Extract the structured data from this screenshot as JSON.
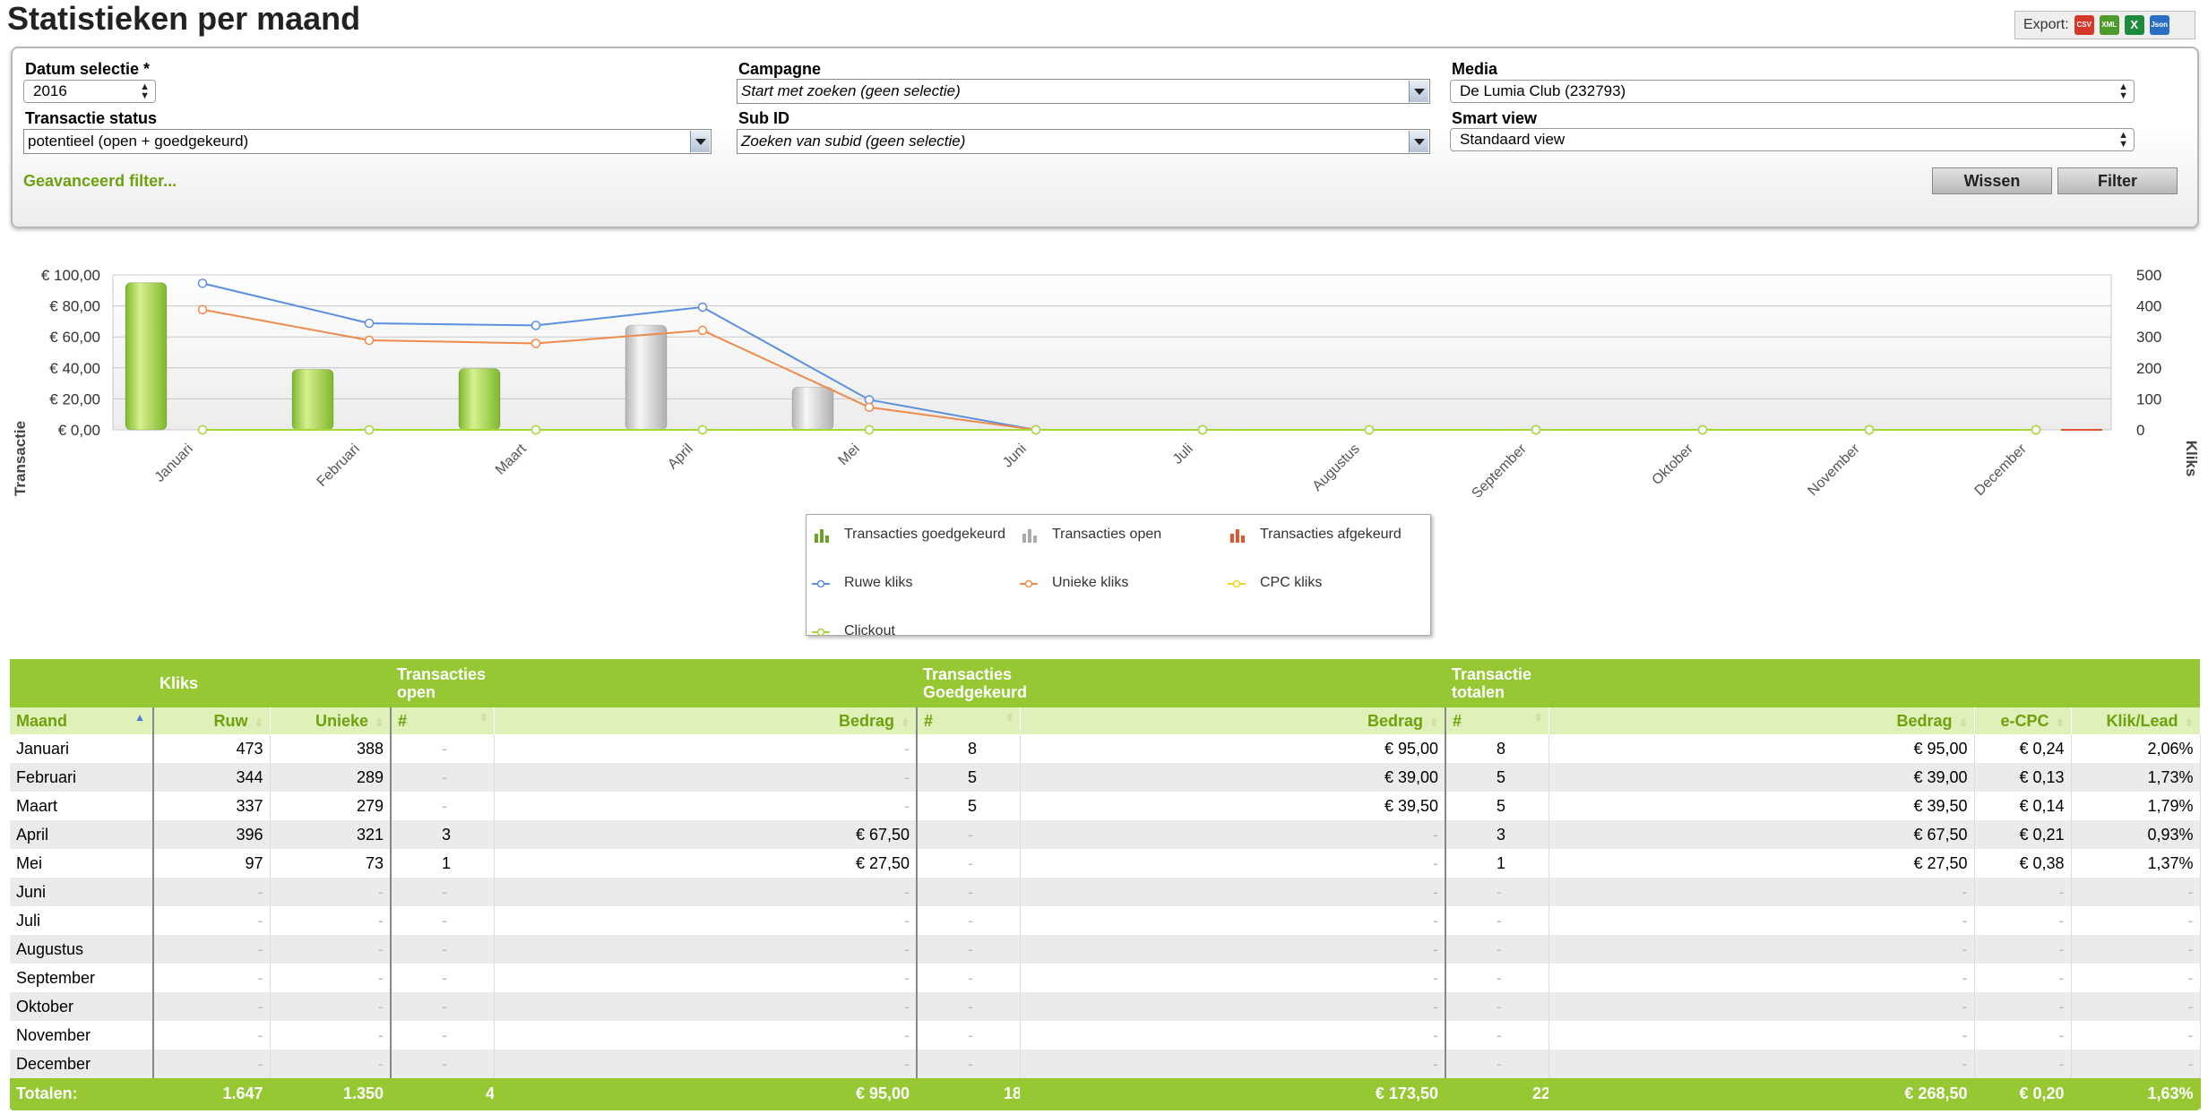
{
  "page": {
    "title": "Statistieken per maand"
  },
  "export": {
    "label": "Export:",
    "formats": [
      {
        "name": "CSV",
        "color": "#d6372b"
      },
      {
        "name": "XML",
        "color": "#4f9a2a"
      },
      {
        "name": "X",
        "color": "#1e8a3c"
      },
      {
        "name": "Json",
        "color": "#2a6fc4"
      }
    ]
  },
  "filters": {
    "datum": {
      "label": "Datum selectie *",
      "value": "2016"
    },
    "transactie_status": {
      "label": "Transactie status",
      "value": "potentieel (open + goedgekeurd)"
    },
    "campagne": {
      "label": "Campagne",
      "value": "Start met zoeken (geen selectie)"
    },
    "subid": {
      "label": "Sub ID",
      "value": "Zoeken van subid (geen selectie)"
    },
    "media": {
      "label": "Media",
      "value": "De Lumia Club (232793)"
    },
    "smart_view": {
      "label": "Smart view",
      "value": "Standaard view"
    },
    "advanced_link": "Geavanceerd filter...",
    "wissen": "Wissen",
    "filter": "Filter"
  },
  "chart_data": {
    "type": "bar+line",
    "categories": [
      "Januari",
      "Februari",
      "Maart",
      "April",
      "Mei",
      "Juni",
      "Juli",
      "Augustus",
      "September",
      "Oktober",
      "November",
      "December"
    ],
    "y_left": {
      "label": "Transactie",
      "range": [
        0,
        100
      ],
      "ticks": [
        "€ 0,00",
        "€ 20,00",
        "€ 40,00",
        "€ 60,00",
        "€ 80,00",
        "€ 100,00"
      ]
    },
    "y_right": {
      "label": "Kliks",
      "range": [
        0,
        500
      ],
      "ticks": [
        "0",
        "100",
        "200",
        "300",
        "400",
        "500"
      ]
    },
    "bar_series": [
      {
        "name": "Transacties goedgekeurd",
        "color": "#8cc63f",
        "values": [
          95,
          39,
          39.5,
          0,
          0,
          0,
          0,
          0,
          0,
          0,
          0,
          0
        ]
      },
      {
        "name": "Transacties open",
        "color": "#bdbdbd",
        "values": [
          0,
          0,
          0,
          67.5,
          27.5,
          0,
          0,
          0,
          0,
          0,
          0,
          0
        ]
      },
      {
        "name": "Transacties afgekeurd",
        "color": "#e2562e",
        "values": [
          0,
          0,
          0,
          0,
          0,
          0,
          0,
          0,
          0,
          0,
          0,
          0
        ]
      }
    ],
    "line_series": [
      {
        "name": "Ruwe kliks",
        "color": "#5b8fe0",
        "values": [
          473,
          344,
          337,
          396,
          97,
          0,
          0,
          0,
          0,
          0,
          0,
          0
        ]
      },
      {
        "name": "Unieke kliks",
        "color": "#f08a4b",
        "values": [
          388,
          289,
          279,
          321,
          73,
          0,
          0,
          0,
          0,
          0,
          0,
          0
        ]
      },
      {
        "name": "CPC kliks",
        "color": "#f5d31c",
        "values": [
          0,
          0,
          0,
          0,
          0,
          0,
          0,
          0,
          0,
          0,
          0,
          0
        ]
      },
      {
        "name": "Clickout",
        "color": "#a9d63a",
        "values": [
          0,
          0,
          0,
          0,
          0,
          0,
          0,
          0,
          0,
          0,
          0,
          0
        ]
      }
    ]
  },
  "table": {
    "groups": [
      "Kliks",
      "Transacties\nopen",
      "Transacties\nGoedgekeurd",
      "Transactie\ntotalen"
    ],
    "headers": [
      "Maand",
      "Ruw",
      "Unieke",
      "#",
      "Bedrag",
      "#",
      "Bedrag",
      "#",
      "Bedrag",
      "e-CPC",
      "Klik/Lead"
    ],
    "rows": [
      [
        "Januari",
        "473",
        "388",
        "-",
        "-",
        "8",
        "€ 95,00",
        "8",
        "€ 95,00",
        "€ 0,24",
        "2,06%"
      ],
      [
        "Februari",
        "344",
        "289",
        "-",
        "-",
        "5",
        "€ 39,00",
        "5",
        "€ 39,00",
        "€ 0,13",
        "1,73%"
      ],
      [
        "Maart",
        "337",
        "279",
        "-",
        "-",
        "5",
        "€ 39,50",
        "5",
        "€ 39,50",
        "€ 0,14",
        "1,79%"
      ],
      [
        "April",
        "396",
        "321",
        "3",
        "€ 67,50",
        "-",
        "-",
        "3",
        "€ 67,50",
        "€ 0,21",
        "0,93%"
      ],
      [
        "Mei",
        "97",
        "73",
        "1",
        "€ 27,50",
        "-",
        "-",
        "1",
        "€ 27,50",
        "€ 0,38",
        "1,37%"
      ],
      [
        "Juni",
        "-",
        "-",
        "-",
        "-",
        "-",
        "-",
        "-",
        "-",
        "-",
        "-"
      ],
      [
        "Juli",
        "-",
        "-",
        "-",
        "-",
        "-",
        "-",
        "-",
        "-",
        "-",
        "-"
      ],
      [
        "Augustus",
        "-",
        "-",
        "-",
        "-",
        "-",
        "-",
        "-",
        "-",
        "-",
        "-"
      ],
      [
        "September",
        "-",
        "-",
        "-",
        "-",
        "-",
        "-",
        "-",
        "-",
        "-",
        "-"
      ],
      [
        "Oktober",
        "-",
        "-",
        "-",
        "-",
        "-",
        "-",
        "-",
        "-",
        "-",
        "-"
      ],
      [
        "November",
        "-",
        "-",
        "-",
        "-",
        "-",
        "-",
        "-",
        "-",
        "-",
        "-"
      ],
      [
        "December",
        "-",
        "-",
        "-",
        "-",
        "-",
        "-",
        "-",
        "-",
        "-",
        "-"
      ]
    ],
    "totals": [
      "Totalen:",
      "1.647",
      "1.350",
      "4",
      "€ 95,00",
      "18",
      "€ 173,50",
      "22",
      "€ 268,50",
      "€ 0,20",
      "1,63%"
    ]
  }
}
